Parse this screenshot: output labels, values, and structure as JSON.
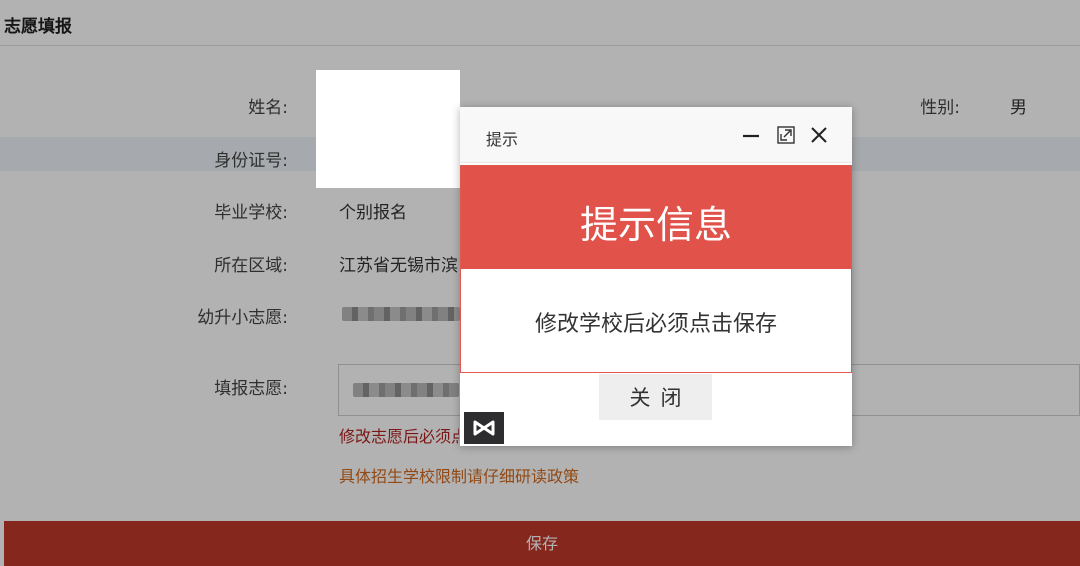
{
  "page": {
    "title": "志愿填报",
    "save_label": "保存"
  },
  "form": {
    "name_label": "姓名:",
    "gender_label": "性别:",
    "gender_value": "男",
    "id_label": "身份证号:",
    "school_label": "毕业学校:",
    "school_value": "个别报名",
    "region_label": "所在区域:",
    "region_value": "江苏省无锡市滨",
    "kindergarten_label": "幼升小志愿:",
    "volunteer_label": "填报志愿:",
    "note_red": "修改志愿后必须点击保存",
    "note_orange": "具体招生学校限制请仔细研读政策"
  },
  "dialog": {
    "title": "提示",
    "banner": "提示信息",
    "message": "修改学校后必须点击保存",
    "close_label": "关闭",
    "colors": {
      "banner": "#e0524a",
      "border": "#e05a52"
    }
  },
  "icons": [
    "minimize-icon",
    "maximize-icon",
    "close-icon",
    "visual-studio-icon"
  ]
}
